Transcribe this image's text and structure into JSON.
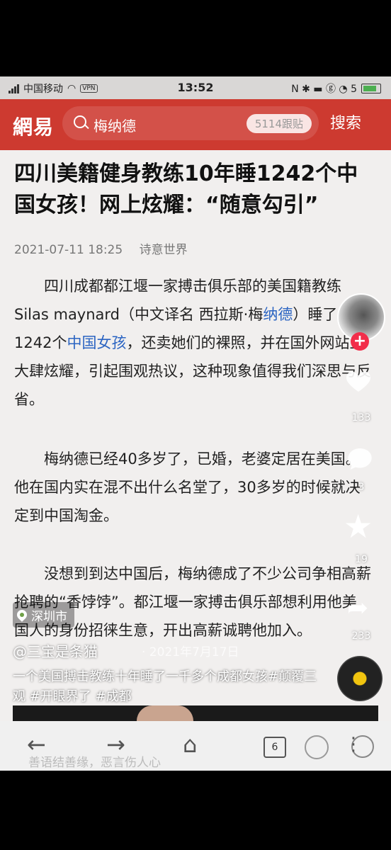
{
  "status_bar": {
    "carrier": "中国移动",
    "vpn": "VPN",
    "time": "13:52",
    "right_icons": "N ✱ ▬ ⓖ ◔ 5"
  },
  "header": {
    "logo": "網易",
    "search_keyword": "梅纳德",
    "follow_count": "5114跟贴",
    "search_button": "搜索"
  },
  "article": {
    "title": "四川美籍健身教练10年睡1242个中国女孩！网上炫耀：“随意勾引”",
    "date": "2021-07-11 18:25",
    "source": "诗意世界",
    "p1_a": "四川成都都江堰一家搏击俱乐部的美国籍教练Silas maynard（中文译名 西拉斯·梅",
    "p1_link1": "纳德",
    "p1_b": "）睡了1242个",
    "p1_link2": "中国女孩",
    "p1_c": "，还卖她们的裸照，并在国外网站上大肆炫耀，引起围观热议，这种现象值得我们深思与反省。",
    "p2": "梅纳德已经40多岁了，已婚，老婆定居在美国。他在国内实在混不出什么名堂了，30多岁的时候就决定到中国淘金。",
    "p3": "没想到到达中国后，梅纳德成了不少公司争相高薪抢聘的“香饽饽”。都江堰一家搏击俱乐部想利用他美国人的身份招徕生意，开出高薪诚聘他加入。"
  },
  "overlay": {
    "follow_plus": "+",
    "like_count": "133",
    "comment_count": "3",
    "fav_count": "19",
    "share_count": "233",
    "location": "深圳市",
    "author": "@三宝是条猫",
    "post_date": "· 2021年7月17日",
    "caption": "一个美国搏击教练十年睡了一千多个成都女孩#颠覆三观 #开眼界了 #成都"
  },
  "bottom_bar": {
    "comment_hint": "善语结善缘，恶言伤人心",
    "back": "←",
    "forward": "→",
    "home": "⌂",
    "tabs": "6",
    "more": "⋮"
  }
}
